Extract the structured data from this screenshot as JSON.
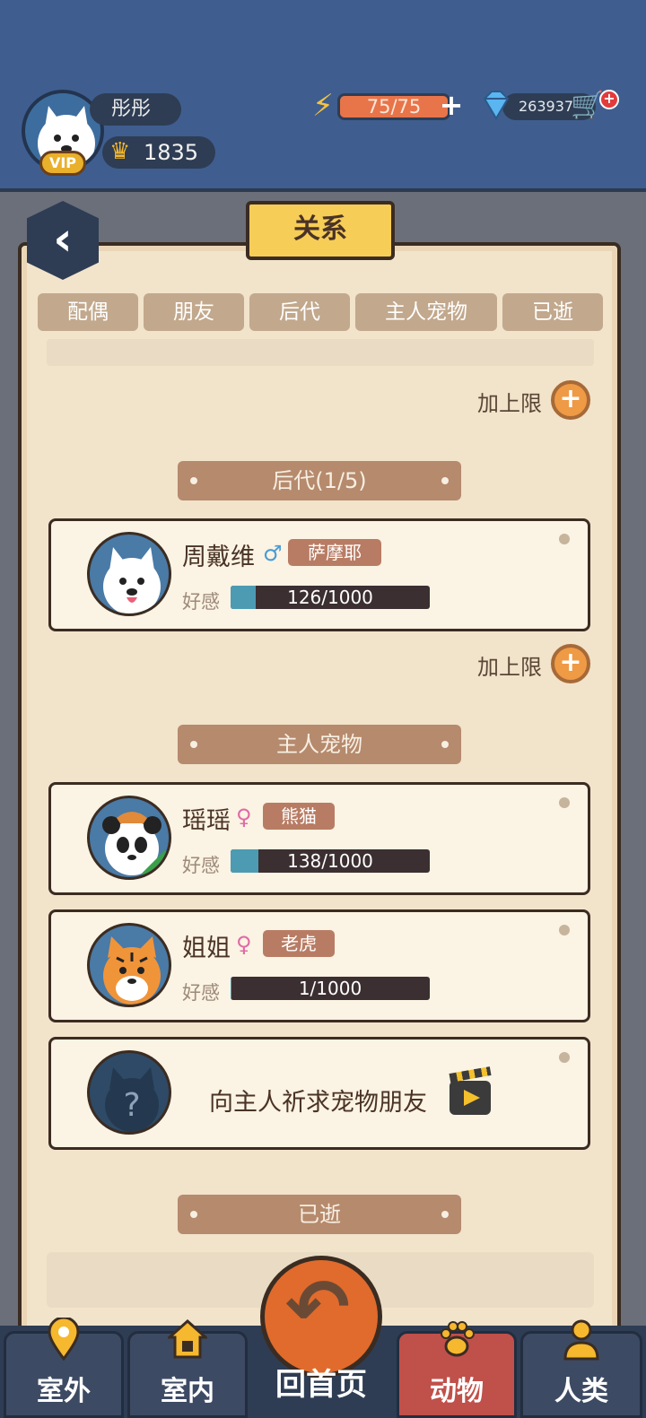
{
  "player": {
    "name": "彤彤",
    "vip_label": "VIP",
    "score": "1835",
    "energy": "75/75",
    "gems": "263937"
  },
  "screen": {
    "title": "关系"
  },
  "tabs": [
    {
      "label": "配偶"
    },
    {
      "label": "朋友"
    },
    {
      "label": "后代"
    },
    {
      "label": "主人宠物"
    },
    {
      "label": "已逝"
    }
  ],
  "add_limit_label": "加上限",
  "sections": {
    "offspring": {
      "header": "后代(1/5)"
    },
    "owner_pets": {
      "header": "主人宠物"
    },
    "deceased": {
      "header": "已逝"
    }
  },
  "affinity_label": "好感",
  "offspring_cards": [
    {
      "name": "周戴维",
      "gender": "♂",
      "gender_color": "#4a9bd6",
      "breed": "萨摩耶",
      "affinity": "126/1000",
      "affinity_fraction": 0.126,
      "avatar_icon": "samoyed-icon"
    }
  ],
  "pet_cards": [
    {
      "name": "瑶瑶",
      "gender": "♀",
      "gender_color": "#e06aa6",
      "breed": "熊猫",
      "affinity": "138/1000",
      "affinity_fraction": 0.138,
      "avatar_icon": "panda-icon"
    },
    {
      "name": "姐姐",
      "gender": "♀",
      "gender_color": "#e06aa6",
      "breed": "老虎",
      "affinity": "1/1000",
      "affinity_fraction": 0.001,
      "avatar_icon": "tiger-icon"
    }
  ],
  "request_card": {
    "prompt": "向主人祈求宠物朋友",
    "placeholder_glyph": "?"
  },
  "bottom_nav": [
    {
      "label": "室外",
      "icon": "location-pin-icon"
    },
    {
      "label": "室内",
      "icon": "house-icon"
    },
    {
      "label": "回首页",
      "icon": "return-arrow-icon"
    },
    {
      "label": "动物",
      "icon": "paw-icon"
    },
    {
      "label": "人类",
      "icon": "person-icon"
    }
  ]
}
